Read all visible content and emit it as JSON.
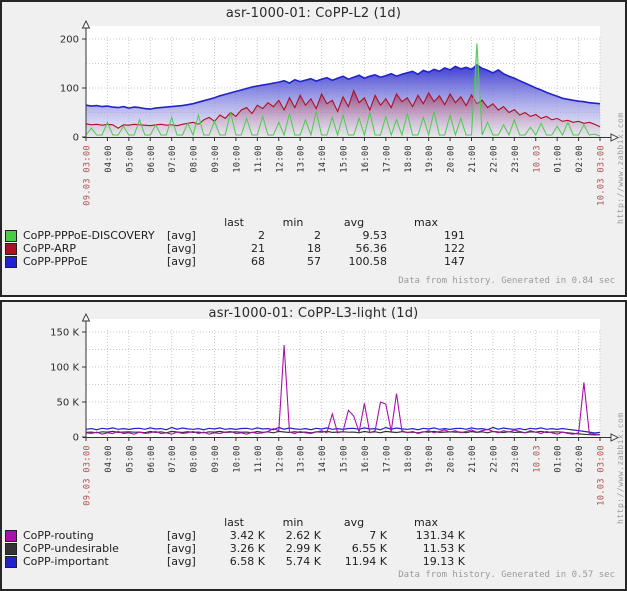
{
  "chart_data": [
    {
      "type": "area",
      "title": "asr-1000-01: CoPP-L2  (1d)",
      "ylim": [
        0,
        200
      ],
      "y_unit": "",
      "grid_lines": [
        50,
        100,
        150,
        200
      ],
      "y_ticks": [
        {
          "label": "200",
          "value": 200
        },
        {
          "label": "100",
          "value": 100
        },
        {
          "label": "0",
          "value": 0
        }
      ],
      "x_labels": [
        {
          "t": "09.03 03:00",
          "red": true
        },
        {
          "t": "04:00"
        },
        {
          "t": "05:00"
        },
        {
          "t": "06:00"
        },
        {
          "t": "07:00"
        },
        {
          "t": "08:00"
        },
        {
          "t": "09:00"
        },
        {
          "t": "10:00"
        },
        {
          "t": "11:00"
        },
        {
          "t": "12:00"
        },
        {
          "t": "13:00"
        },
        {
          "t": "14:00"
        },
        {
          "t": "15:00"
        },
        {
          "t": "16:00"
        },
        {
          "t": "17:00"
        },
        {
          "t": "18:00"
        },
        {
          "t": "19:00"
        },
        {
          "t": "20:00"
        },
        {
          "t": "21:00"
        },
        {
          "t": "22:00"
        },
        {
          "t": "23:00"
        },
        {
          "t": "10.03",
          "red": true
        },
        {
          "t": "01:00"
        },
        {
          "t": "02:00"
        },
        {
          "t": "10.03 03:00",
          "red": true
        }
      ],
      "legend_headers": [
        "last",
        "min",
        "avg",
        "max"
      ],
      "series": [
        {
          "name": "CoPP-PPPoE-DISCOVERY",
          "func": "[avg]",
          "color": "#4ACC4A",
          "line_width": 1,
          "fill": {
            "top": "rgba(90,190,90,0.45)",
            "bottom": "rgba(210,225,210,0.15)"
          },
          "legend": {
            "last": "2",
            "min": "2",
            "avg": "9.53",
            "max": "191"
          },
          "values": [
            4,
            18,
            4,
            4,
            30,
            4,
            4,
            22,
            4,
            4,
            35,
            4,
            4,
            25,
            4,
            4,
            40,
            4,
            4,
            28,
            4,
            45,
            4,
            4,
            32,
            4,
            4,
            50,
            4,
            4,
            38,
            4,
            4,
            42,
            4,
            4,
            30,
            4,
            48,
            4,
            4,
            35,
            4,
            52,
            4,
            4,
            40,
            4,
            45,
            4,
            4,
            38,
            4,
            50,
            4,
            4,
            42,
            4,
            35,
            4,
            48,
            4,
            4,
            40,
            4,
            52,
            4,
            4,
            45,
            4,
            38,
            4,
            4,
            191,
            4,
            30,
            4,
            4,
            25,
            4,
            35,
            4,
            4,
            20,
            4,
            28,
            4,
            4,
            22,
            4,
            30,
            4,
            4,
            25,
            4,
            6,
            2
          ]
        },
        {
          "name": "CoPP-ARP",
          "func": "[avg]",
          "color": "#AA1122",
          "line_width": 1.1,
          "fill": {
            "top": "rgba(160,25,60,0.60)",
            "bottom": "rgba(225,210,220,0.25)"
          },
          "legend": {
            "last": "21",
            "min": "18",
            "avg": "56.36",
            "max": "122"
          },
          "values": [
            27,
            25,
            26,
            24,
            26,
            25,
            18,
            25,
            24,
            26,
            25,
            24,
            23,
            25,
            26,
            24,
            25,
            23,
            26,
            28,
            30,
            26,
            35,
            40,
            32,
            45,
            38,
            50,
            42,
            55,
            60,
            48,
            65,
            58,
            70,
            62,
            75,
            55,
            80,
            60,
            85,
            65,
            78,
            58,
            88,
            68,
            75,
            52,
            82,
            62,
            95,
            70,
            80,
            55,
            85,
            65,
            78,
            60,
            88,
            72,
            80,
            62,
            85,
            68,
            90,
            72,
            84,
            66,
            88,
            70,
            82,
            64,
            86,
            68,
            75,
            60,
            68,
            55,
            62,
            50,
            56,
            45,
            50,
            42,
            46,
            38,
            42,
            35,
            38,
            32,
            34,
            30,
            32,
            28,
            30,
            26,
            21
          ]
        },
        {
          "name": "CoPP-PPPoE",
          "func": "[avg]",
          "color": "#2222CC",
          "line_width": 1.6,
          "fill": {
            "top": "rgba(38,38,205,0.90)",
            "bottom": "rgba(222,222,242,0.50)"
          },
          "legend": {
            "last": "68",
            "min": "57",
            "avg": "100.58",
            "max": "147"
          },
          "values": [
            65,
            63,
            64,
            62,
            63,
            61,
            60,
            62,
            59,
            61,
            60,
            58,
            57,
            59,
            60,
            61,
            62,
            63,
            64,
            66,
            68,
            71,
            74,
            77,
            80,
            84,
            87,
            90,
            93,
            96,
            99,
            102,
            104,
            106,
            108,
            110,
            112,
            115,
            110,
            117,
            113,
            116,
            119,
            114,
            118,
            121,
            116,
            120,
            124,
            118,
            122,
            126,
            120,
            124,
            127,
            122,
            125,
            129,
            124,
            128,
            131,
            134,
            128,
            136,
            132,
            138,
            134,
            141,
            137,
            144,
            139,
            142,
            138,
            147,
            140,
            136,
            131,
            137,
            129,
            124,
            120,
            115,
            110,
            105,
            100,
            96,
            91,
            87,
            83,
            79,
            77,
            75,
            73,
            72,
            70,
            69,
            68
          ]
        }
      ],
      "footer": "Data from history. Generated in 0.84 sec",
      "watermark": "http://www.zabbix.com"
    },
    {
      "type": "line",
      "title": "asr-1000-01: CoPP-L3-light  (1d)",
      "ylim": [
        0,
        150
      ],
      "y_unit": "K",
      "grid_lines": [
        25,
        50,
        75,
        100,
        125,
        150
      ],
      "y_ticks": [
        {
          "label": "150 K",
          "value": 150
        },
        {
          "label": "100 K",
          "value": 100
        },
        {
          "label": "50 K",
          "value": 50
        },
        {
          "label": "0",
          "value": 0
        }
      ],
      "x_labels": [
        {
          "t": "09.03 03:00",
          "red": true
        },
        {
          "t": "04:00"
        },
        {
          "t": "05:00"
        },
        {
          "t": "06:00"
        },
        {
          "t": "07:00"
        },
        {
          "t": "08:00"
        },
        {
          "t": "09:00"
        },
        {
          "t": "10:00"
        },
        {
          "t": "11:00"
        },
        {
          "t": "12:00"
        },
        {
          "t": "13:00"
        },
        {
          "t": "14:00"
        },
        {
          "t": "15:00"
        },
        {
          "t": "16:00"
        },
        {
          "t": "17:00"
        },
        {
          "t": "18:00"
        },
        {
          "t": "19:00"
        },
        {
          "t": "20:00"
        },
        {
          "t": "21:00"
        },
        {
          "t": "22:00"
        },
        {
          "t": "23:00"
        },
        {
          "t": "10.03",
          "red": true
        },
        {
          "t": "01:00"
        },
        {
          "t": "02:00"
        },
        {
          "t": "10.03 03:00",
          "red": true
        }
      ],
      "legend_headers": [
        "last",
        "min",
        "avg",
        "max"
      ],
      "series": [
        {
          "name": "CoPP-routing",
          "func": "[avg]",
          "color": "#AA11AA",
          "line_width": 1.1,
          "fill": null,
          "legend": {
            "last": "3.42 K",
            "min": "2.62 K",
            "avg": "7 K",
            "max": "131.34 K"
          },
          "values": [
            6,
            5,
            7,
            4,
            6,
            5,
            8,
            5,
            6,
            4,
            7,
            5,
            6,
            8,
            5,
            6,
            4,
            7,
            5,
            6,
            8,
            5,
            7,
            4,
            6,
            5,
            7,
            8,
            5,
            6,
            4,
            7,
            5,
            6,
            8,
            12,
            9,
            131.3,
            7,
            5,
            8,
            6,
            5,
            7,
            9,
            6,
            33,
            6,
            8,
            38,
            30,
            7,
            48,
            6,
            9,
            50,
            47,
            8,
            62,
            9,
            6,
            8,
            5,
            7,
            9,
            6,
            8,
            10,
            7,
            9,
            6,
            8,
            10,
            7,
            9,
            11,
            8,
            6,
            9,
            7,
            10,
            8,
            6,
            9,
            7,
            5,
            8,
            6,
            4,
            7,
            5,
            4,
            6,
            78,
            5,
            4,
            3.4
          ]
        },
        {
          "name": "CoPP-undesirable",
          "func": "[avg]",
          "color": "#333333",
          "line_width": 1.2,
          "fill": null,
          "legend": {
            "last": "3.26 K",
            "min": "2.99 K",
            "avg": "6.55 K",
            "max": "11.53 K"
          },
          "values": [
            6.5,
            7,
            6,
            7.5,
            7,
            8,
            6.5,
            7,
            7.5,
            6.8,
            7,
            6.2,
            7.8,
            6.6,
            7.4,
            6,
            8,
            7.2,
            6.4,
            7.6,
            6.5,
            7,
            6,
            7.5,
            7,
            8,
            6.5,
            7,
            7.5,
            6.8,
            7,
            6.2,
            7.8,
            6.6,
            7.4,
            6,
            8,
            7.2,
            6.4,
            7.6,
            6.5,
            7,
            6,
            7.5,
            7,
            8,
            6.5,
            7,
            7.5,
            6.8,
            7,
            6.2,
            7.8,
            6.6,
            7.4,
            6,
            8,
            7.2,
            6.4,
            7.6,
            6.5,
            7,
            6,
            7.5,
            7,
            8,
            6.5,
            7,
            7.5,
            6.8,
            7,
            6.2,
            7.8,
            6.6,
            7.4,
            6,
            8,
            7.2,
            6.4,
            7.6,
            6.5,
            7,
            6,
            7.5,
            7,
            8,
            6.5,
            7,
            7.5,
            6.8,
            6,
            5.2,
            4.4,
            3.8,
            3.3,
            3,
            3.26
          ]
        },
        {
          "name": "CoPP-important",
          "func": "[avg]",
          "color": "#2222CC",
          "line_width": 1.2,
          "fill": null,
          "legend": {
            "last": "6.58 K",
            "min": "5.74 K",
            "avg": "11.94 K",
            "max": "19.13 K"
          },
          "values": [
            11,
            12,
            10.5,
            12.5,
            11.5,
            13,
            11,
            12,
            10.8,
            12.2,
            12.5,
            11,
            13,
            11.5,
            12,
            10.5,
            13.5,
            11.2,
            12.8,
            11.6,
            11,
            12,
            10.5,
            12.5,
            11.5,
            13,
            11,
            12,
            10.8,
            12.2,
            12.5,
            11,
            13,
            11.5,
            12,
            10.5,
            13.5,
            11.2,
            12.8,
            11.6,
            11,
            12,
            10.5,
            12.5,
            11.5,
            13,
            11,
            12,
            10.8,
            12.2,
            12.5,
            11,
            13,
            11.5,
            12,
            10.5,
            13.5,
            11.2,
            12.8,
            11.6,
            11,
            12,
            10.5,
            12.5,
            11.5,
            13,
            11,
            12,
            10.8,
            12.2,
            12.5,
            11,
            13,
            11.5,
            12,
            10.5,
            13.5,
            11.2,
            12.8,
            11.6,
            11,
            12,
            10.5,
            12.5,
            11.5,
            13,
            11,
            12,
            10.8,
            12.2,
            11,
            10,
            9,
            8,
            7,
            5.74,
            6.58
          ]
        }
      ],
      "footer": "Data from history. Generated in 0.57 sec",
      "watermark": "http://www.zabbix.com"
    }
  ]
}
